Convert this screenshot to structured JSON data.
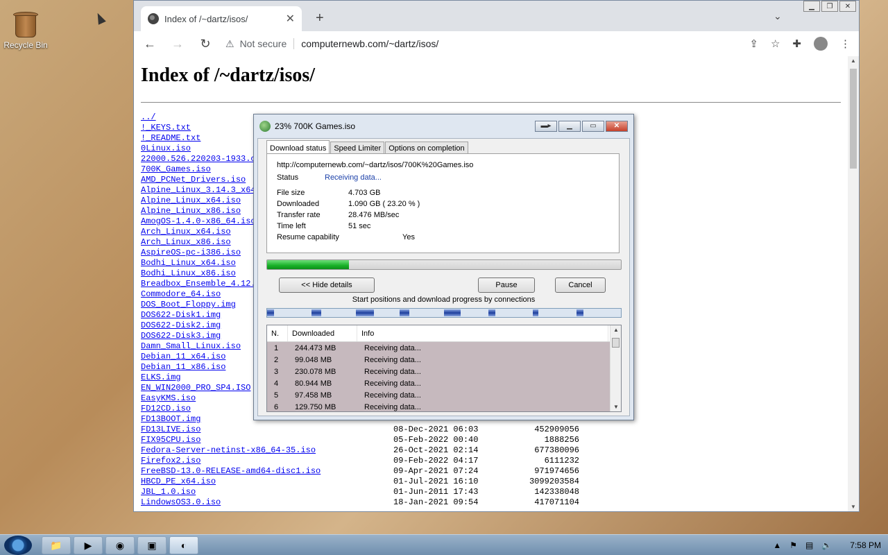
{
  "desktop": {
    "recycle_bin_label": "Recycle Bin"
  },
  "browser": {
    "tab_title": "Index of /~dartz/isos/",
    "security_label": "Not secure",
    "url": "computernewb.com/~dartz/isos/",
    "page_heading": "Index of /~dartz/isos/"
  },
  "listing": [
    {
      "name": "../",
      "date": "",
      "size": ""
    },
    {
      "name": "!_KEYS.txt",
      "date": "",
      "size": ""
    },
    {
      "name": "!_README.txt",
      "date": "",
      "size": ""
    },
    {
      "name": "0Linux.iso",
      "date": "",
      "size": ""
    },
    {
      "name": "22000.526.220203-1933.c",
      "date": "",
      "size": ""
    },
    {
      "name": "700K_Games.iso",
      "date": "",
      "size": ""
    },
    {
      "name": "AMD_PCNet_Drivers.iso",
      "date": "",
      "size": ""
    },
    {
      "name": "Alpine_Linux_3.14.3_x64",
      "date": "",
      "size": ""
    },
    {
      "name": "Alpine_Linux_x64.iso",
      "date": "",
      "size": ""
    },
    {
      "name": "Alpine_Linux_x86.iso",
      "date": "",
      "size": ""
    },
    {
      "name": "AmogOS-1.4.0-x86_64.iso",
      "date": "",
      "size": ""
    },
    {
      "name": "Arch_Linux_x64.iso",
      "date": "",
      "size": ""
    },
    {
      "name": "Arch_Linux_x86.iso",
      "date": "",
      "size": ""
    },
    {
      "name": "AspireOS-pc-i386.iso",
      "date": "",
      "size": ""
    },
    {
      "name": "Bodhi_Linux_x64.iso",
      "date": "",
      "size": ""
    },
    {
      "name": "Bodhi_Linux_x86.iso",
      "date": "",
      "size": ""
    },
    {
      "name": "Breadbox_Ensemble_4.12.",
      "date": "",
      "size": ""
    },
    {
      "name": "Commodore_64.iso",
      "date": "",
      "size": ""
    },
    {
      "name": "DOS_Boot_Floppy.img",
      "date": "",
      "size": ""
    },
    {
      "name": "DOS622-Disk1.img",
      "date": "",
      "size": ""
    },
    {
      "name": "DOS622-Disk2.img",
      "date": "",
      "size": ""
    },
    {
      "name": "DOS622-Disk3.img",
      "date": "",
      "size": ""
    },
    {
      "name": "Damn_Small_Linux.iso",
      "date": "",
      "size": ""
    },
    {
      "name": "Debian_11_x64.iso",
      "date": "",
      "size": ""
    },
    {
      "name": "Debian_11_x86.iso",
      "date": "",
      "size": ""
    },
    {
      "name": "ELKS.img",
      "date": "",
      "size": ""
    },
    {
      "name": "EN_WIN2000_PRO_SP4.ISO",
      "date": "",
      "size": ""
    },
    {
      "name": "EasyKMS.iso",
      "date": "",
      "size": ""
    },
    {
      "name": "FD12CD.iso",
      "date": "",
      "size": ""
    },
    {
      "name": "FD13BOOT.img",
      "date": "",
      "size": ""
    },
    {
      "name": "FD13LIVE.iso",
      "date": "08-Dec-2021 06:03",
      "size": "452909056"
    },
    {
      "name": "FIX95CPU.iso",
      "date": "05-Feb-2022 00:40",
      "size": "1888256"
    },
    {
      "name": "Fedora-Server-netinst-x86_64-35.iso",
      "date": "26-Oct-2021 02:14",
      "size": "677380096"
    },
    {
      "name": "Firefox2.iso",
      "date": "09-Feb-2022 04:17",
      "size": "6111232"
    },
    {
      "name": "FreeBSD-13.0-RELEASE-amd64-disc1.iso",
      "date": "09-Apr-2021 07:24",
      "size": "971974656"
    },
    {
      "name": "HBCD_PE_x64.iso",
      "date": "01-Jul-2021 16:10",
      "size": "3099203584"
    },
    {
      "name": "JBL_1.0.iso",
      "date": "01-Jun-2011 17:43",
      "size": "142338048"
    },
    {
      "name": "LindowsOS3.0.iso",
      "date": "18-Jan-2021 09:54",
      "size": "417071104"
    }
  ],
  "dialog": {
    "title": "23% 700K Games.iso",
    "tabs": [
      "Download status",
      "Speed Limiter",
      "Options on completion"
    ],
    "url": "http://computernewb.com/~dartz/isos/700K%20Games.iso",
    "status_label": "Status",
    "status_value": "Receiving data...",
    "file_size_label": "File size",
    "file_size_value": "4.703  GB",
    "downloaded_label": "Downloaded",
    "downloaded_value": "1.090  GB  ( 23.20 % )",
    "transfer_rate_label": "Transfer rate",
    "transfer_rate_value": "28.476  MB/sec",
    "time_left_label": "Time left",
    "time_left_value": "51 sec",
    "resume_label": "Resume capability",
    "resume_value": "Yes",
    "progress_fraction": 0.232,
    "hide_details_label": "<< Hide details",
    "pause_label": "Pause",
    "cancel_label": "Cancel",
    "connections_label": "Start positions and download progress by connections",
    "connection_progress": [
      0.0,
      0.125,
      0.25,
      0.375,
      0.5,
      0.625,
      0.75,
      0.875
    ],
    "table_headers": [
      "N.",
      "Downloaded",
      "Info"
    ],
    "connections": [
      {
        "n": "1",
        "downloaded": "244.473  MB",
        "info": "Receiving data..."
      },
      {
        "n": "2",
        "downloaded": "99.048  MB",
        "info": "Receiving data..."
      },
      {
        "n": "3",
        "downloaded": "230.078  MB",
        "info": "Receiving data..."
      },
      {
        "n": "4",
        "downloaded": "80.944  MB",
        "info": "Receiving data..."
      },
      {
        "n": "5",
        "downloaded": "97.458  MB",
        "info": "Receiving data..."
      },
      {
        "n": "6",
        "downloaded": "129.750  MB",
        "info": "Receiving data..."
      }
    ]
  },
  "taskbar": {
    "clock": "7:58 PM"
  },
  "colors": {
    "link": "#0000ee",
    "progress_green": "#18b027",
    "row_highlight": "#c6b9be"
  }
}
